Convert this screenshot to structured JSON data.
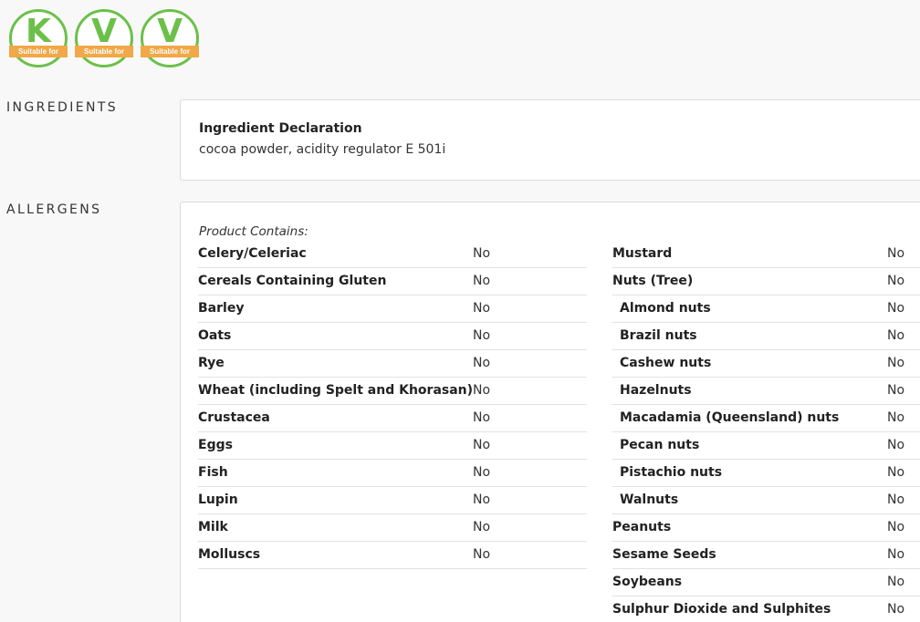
{
  "badges": [
    {
      "letter": "K",
      "ribbon": "Suitable for"
    },
    {
      "letter": "V",
      "ribbon": "Suitable for"
    },
    {
      "letter": "V",
      "ribbon": "Suitable for"
    }
  ],
  "sections": {
    "ingredients_label": "INGREDIENTS",
    "allergens_label": "ALLERGENS"
  },
  "ingredients": {
    "title": "Ingredient Declaration",
    "text": "cocoa powder, acidity regulator E 501i"
  },
  "allergens": {
    "contains_label": "Product Contains:",
    "left": [
      {
        "name": "Celery/Celeriac",
        "value": "No"
      },
      {
        "name": "Cereals Containing Gluten",
        "value": "No"
      },
      {
        "name": "Barley",
        "value": "No"
      },
      {
        "name": "Oats",
        "value": "No"
      },
      {
        "name": "Rye",
        "value": "No"
      },
      {
        "name": "Wheat (including Spelt and Khorasan)",
        "value": "No"
      },
      {
        "name": "Crustacea",
        "value": "No"
      },
      {
        "name": "Eggs",
        "value": "No"
      },
      {
        "name": "Fish",
        "value": "No"
      },
      {
        "name": "Lupin",
        "value": "No"
      },
      {
        "name": "Milk",
        "value": "No"
      },
      {
        "name": "Molluscs",
        "value": "No"
      }
    ],
    "right": [
      {
        "name": "Mustard",
        "value": "No"
      },
      {
        "name": "Nuts (Tree)",
        "value": "No"
      },
      {
        "name": "Almond nuts",
        "value": "No"
      },
      {
        "name": "Brazil nuts",
        "value": "No"
      },
      {
        "name": "Cashew nuts",
        "value": "No"
      },
      {
        "name": "Hazelnuts",
        "value": "No"
      },
      {
        "name": "Macadamia (Queensland) nuts",
        "value": "No"
      },
      {
        "name": "Pecan nuts",
        "value": "No"
      },
      {
        "name": "Pistachio nuts",
        "value": "No"
      },
      {
        "name": "Walnuts",
        "value": "No"
      },
      {
        "name": "Peanuts",
        "value": "No"
      },
      {
        "name": "Sesame Seeds",
        "value": "No"
      },
      {
        "name": "Soybeans",
        "value": "No"
      },
      {
        "name": "Sulphur Dioxide and Sulphites",
        "value": "No"
      }
    ]
  }
}
